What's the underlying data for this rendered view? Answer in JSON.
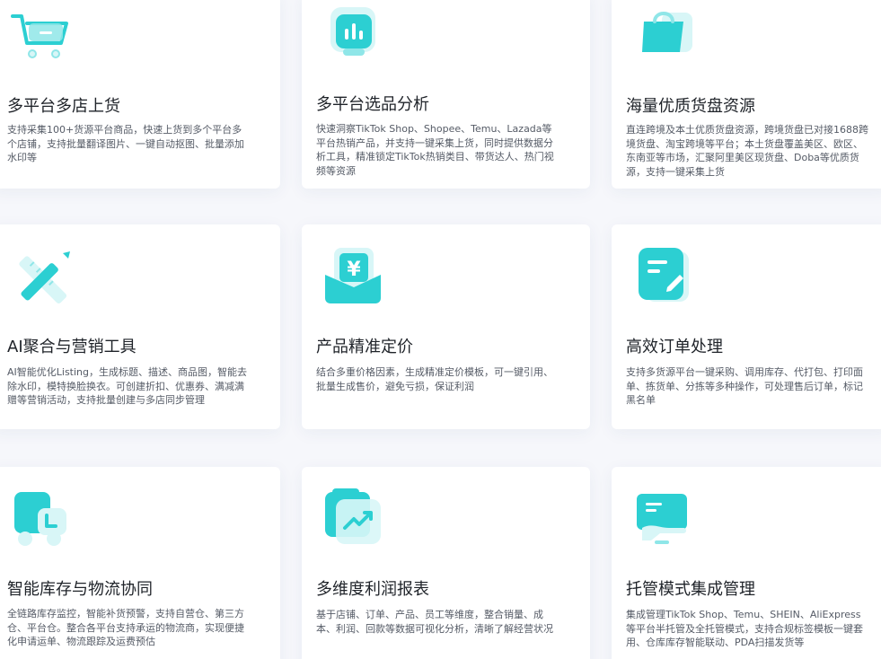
{
  "features": [
    {
      "icon": "shopping-cart-icon",
      "title": "多平台多店上货",
      "desc": "支持采集100+货源平台商品，快速上货到多个平台多个店铺，支持批量翻译图片、一键自动抠图、批量添加水印等"
    },
    {
      "icon": "bar-chart-icon",
      "title": "多平台选品分析",
      "desc": "快速洞察TikTok Shop、Shopee、Temu、Lazada等平台热销产品，并支持一键采集上货，同时提供数据分析工具，精准锁定TikTok热销类目、带货达人、热门视频等资源"
    },
    {
      "icon": "shopping-bag-icon",
      "title": "海量优质货盘资源",
      "desc": "直连跨境及本土优质货盘资源，跨境货盘已对接1688跨境货盘、淘宝跨境等平台；本土货盘覆盖美区、欧区、东南亚等市场，汇聚阿里美区现货盘、Doba等优质货源，支持一键采集上货"
    },
    {
      "icon": "ruler-pencil-icon",
      "title": "AI聚合与营销工具",
      "desc": "AI智能优化Listing，生成标题、描述、商品图，智能去除水印，模特换脸换衣。可创建折扣、优惠券、满减满赠等营销活动，支持批量创建与多店同步管理"
    },
    {
      "icon": "yen-price-icon",
      "title": "产品精准定价",
      "desc": "结合多重价格因素，生成精准定价模板，可一键引用、批量生成售价，避免亏损，保证利润"
    },
    {
      "icon": "order-edit-icon",
      "title": "高效订单处理",
      "desc": "支持多货源平台一键采购、调用库存、代打包、打印面单、拣货单、分拣等多种操作，可处理售后订单，标记黑名单"
    },
    {
      "icon": "delivery-truck-icon",
      "title": "智能库存与物流协同",
      "desc": "全链路库存监控，智能补货预警，支持自营仓、第三方仓、平台仓。整合各平台支持承运的物流商，实现便捷化申请运单、物流跟踪及运费预估"
    },
    {
      "icon": "trend-report-icon",
      "title": "多维度利润报表",
      "desc": "基于店铺、订单、产品、员工等维度，整合销量、成本、利润、回款等数据可视化分析，清晰了解经营状况"
    },
    {
      "icon": "monitor-hand-icon",
      "title": "托管模式集成管理",
      "desc": "集成管理TikTok Shop、Temu、SHEIN、AliExpress等平台半托管及全托管模式，支持合规标签模板一键套用、仓库库存智能联动、PDA扫描发货等"
    }
  ],
  "colors": {
    "accent": "#2ccfd2",
    "accent_light": "#8fe6e8",
    "accent_pale": "#d8f6f7",
    "title": "#1f2329",
    "desc": "#555b66",
    "background": "#f6f7fb",
    "card": "#ffffff"
  }
}
